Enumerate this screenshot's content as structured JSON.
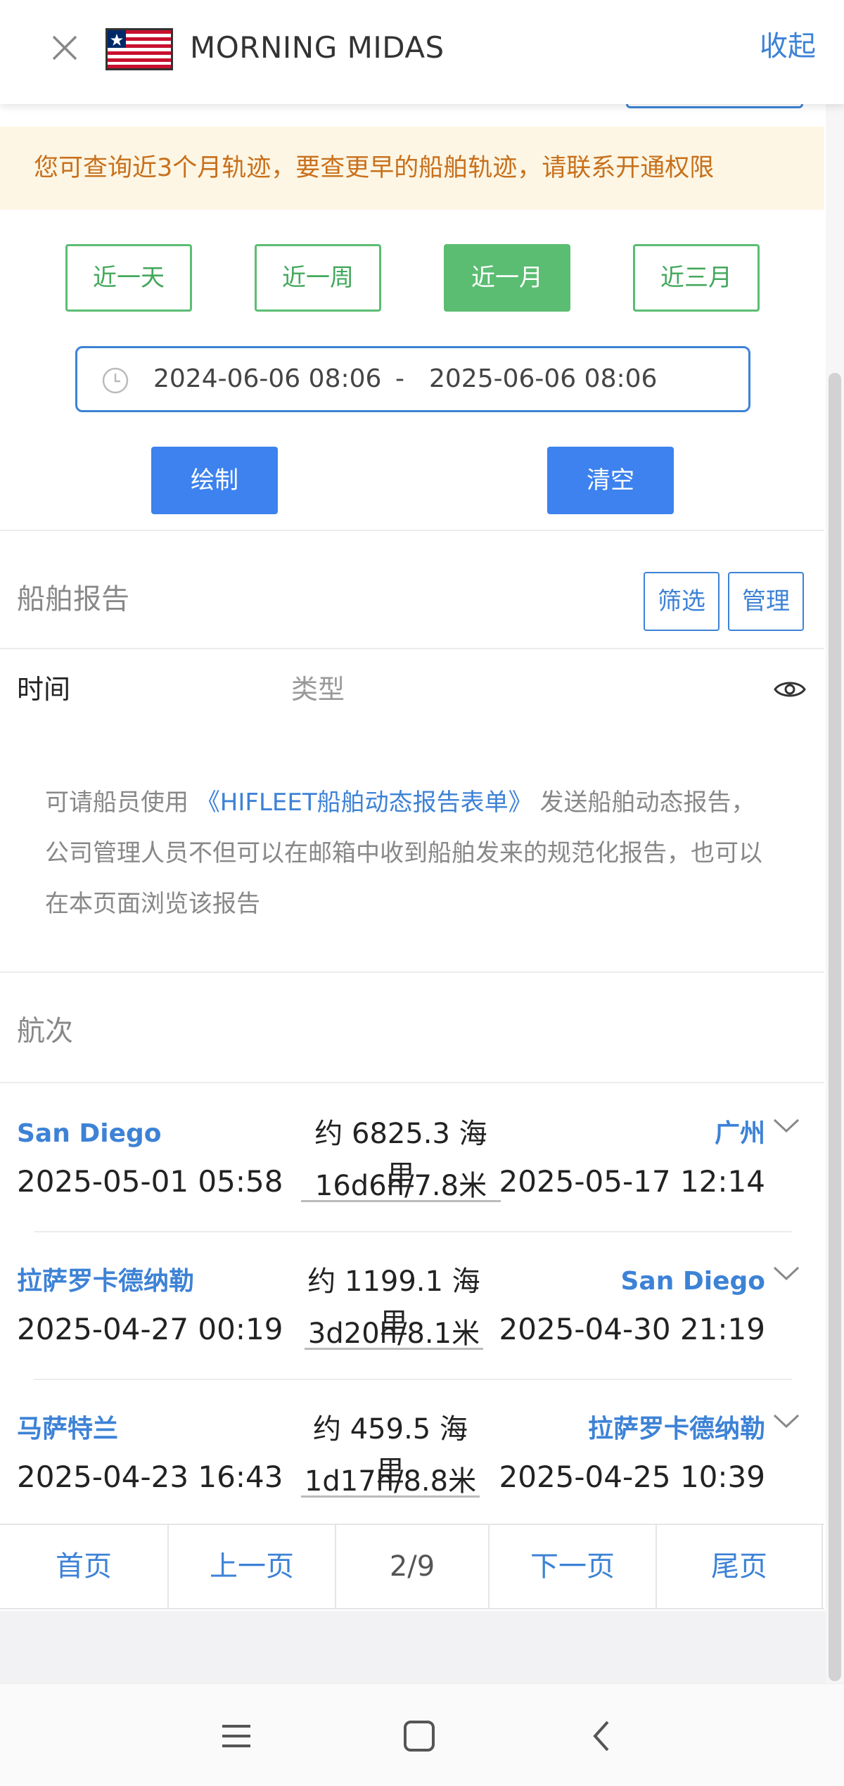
{
  "header": {
    "vessel_name": "MORNING MIDAS",
    "collapse_label": "收起",
    "close_icon": "close-icon",
    "flag_icon": "liberia-flag-icon"
  },
  "notice": {
    "text": "您可查询近3个月轨迹，要查更早的船舶轨迹，请联系开通权限"
  },
  "range_buttons": [
    {
      "label": "近一天",
      "active": false
    },
    {
      "label": "近一周",
      "active": false
    },
    {
      "label": "近一月",
      "active": true
    },
    {
      "label": "近三月",
      "active": false
    }
  ],
  "date_range": {
    "start": "2024-06-06 08:06",
    "separator": "-",
    "end": "2025-06-06 08:06",
    "icon": "clock-icon"
  },
  "actions": {
    "draw_label": "绘制",
    "clear_label": "清空"
  },
  "report": {
    "title": "船舶报告",
    "filter_label": "筛选",
    "manage_label": "管理",
    "col_time": "时间",
    "col_type": "类型",
    "eye_icon": "eye-icon",
    "info_prefix": "可请船员使用",
    "info_link": "《HIFLEET船舶动态报告表单》",
    "info_suffix": "发送船舶动态报告，公司管理人员不但可以在邮箱中收到船舶发来的规范化报告，也可以在本页面浏览该报告"
  },
  "voyages": {
    "title": "航次",
    "items": [
      {
        "from": "San Diego",
        "from_time": "2025-05-01 05:58",
        "distance": "约 6825.3 海里",
        "duration": "16d6h/7.8米",
        "to": "广州",
        "to_time": "2025-05-17 12:14"
      },
      {
        "from": "拉萨罗卡德纳勒",
        "from_time": "2025-04-27 00:19",
        "distance": "约 1199.1 海里",
        "duration": "3d20h/8.1米",
        "to": "San Diego",
        "to_time": "2025-04-30 21:19"
      },
      {
        "from": "马萨特兰",
        "from_time": "2025-04-23 16:43",
        "distance": "约 459.5 海里",
        "duration": "1d17h/8.8米",
        "to": "拉萨罗卡德纳勒",
        "to_time": "2025-04-25 10:39"
      }
    ]
  },
  "pagination": {
    "first": "首页",
    "prev": "上一页",
    "current": "2/9",
    "next": "下一页",
    "last": "尾页"
  },
  "colors": {
    "accent": "#3d82d6",
    "green": "#5bbd72",
    "notice_text": "#c8701c",
    "notice_bg": "#fdf6e4"
  }
}
